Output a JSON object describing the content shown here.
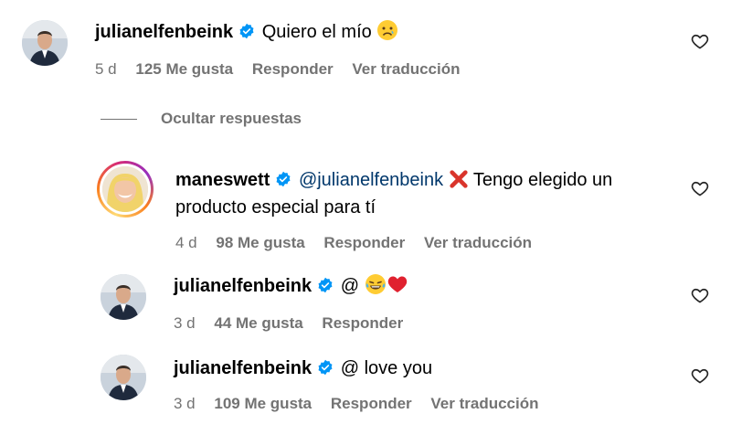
{
  "thread": {
    "hide_replies_label": "Ocultar respuestas"
  },
  "comments": [
    {
      "username": "julianelfenbeink",
      "text": "Quiero el mío",
      "emoji": "sad-face",
      "time": "5 d",
      "likes": "125 Me gusta",
      "reply": "Responder",
      "translate": "Ver traducción"
    },
    {
      "username": "maneswett",
      "mention": "@julianelfenbeink",
      "emoji": "cross-mark",
      "text_line1": "Tengo elegido un",
      "text_line2": "producto especial para tí",
      "time": "4 d",
      "likes": "98 Me gusta",
      "reply": "Responder",
      "translate": "Ver traducción"
    },
    {
      "username": "julianelfenbeink",
      "text": "@",
      "emojis": [
        "tears-of-joy-face",
        "red-heart"
      ],
      "time": "3 d",
      "likes": "44 Me gusta",
      "reply": "Responder"
    },
    {
      "username": "julianelfenbeink",
      "text": "@ love you",
      "time": "3 d",
      "likes": "109 Me gusta",
      "reply": "Responder",
      "translate": "Ver traducción"
    }
  ],
  "colors": {
    "verified": "#0095f6",
    "mention": "#00376b",
    "meta": "#737373"
  },
  "icons": [
    "verified-badge-icon",
    "heart-icon",
    "avatar"
  ]
}
